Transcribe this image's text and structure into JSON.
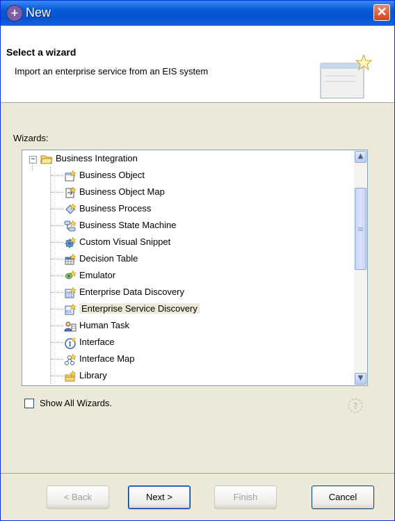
{
  "window": {
    "title": "New"
  },
  "banner": {
    "title": "Select a wizard",
    "description": "Import an enterprise service from an EIS system"
  },
  "wizards": {
    "label": "Wizards:",
    "root": {
      "label": "Business Integration",
      "expanded": true
    },
    "items": [
      {
        "label": "Business Object",
        "icon": "business-object-icon"
      },
      {
        "label": "Business Object Map",
        "icon": "business-object-map-icon"
      },
      {
        "label": "Business Process",
        "icon": "business-process-icon"
      },
      {
        "label": "Business State Machine",
        "icon": "business-state-machine-icon"
      },
      {
        "label": "Custom Visual Snippet",
        "icon": "custom-visual-snippet-icon"
      },
      {
        "label": "Decision Table",
        "icon": "decision-table-icon"
      },
      {
        "label": "Emulator",
        "icon": "emulator-icon"
      },
      {
        "label": "Enterprise Data Discovery",
        "icon": "enterprise-data-discovery-icon"
      },
      {
        "label": "Enterprise Service Discovery",
        "icon": "enterprise-service-discovery-icon",
        "selected": true
      },
      {
        "label": "Human Task",
        "icon": "human-task-icon"
      },
      {
        "label": "Interface",
        "icon": "interface-icon"
      },
      {
        "label": "Interface Map",
        "icon": "interface-map-icon"
      },
      {
        "label": "Library",
        "icon": "library-icon"
      }
    ]
  },
  "show_all": {
    "label": "Show All Wizards.",
    "checked": false
  },
  "buttons": {
    "back": "< Back",
    "next": "Next >",
    "finish": "Finish",
    "cancel": "Cancel"
  },
  "colors": {
    "title_bar": "#0553d3",
    "dialog_bg": "#ece9d8",
    "tree_border": "#7f9db9"
  }
}
